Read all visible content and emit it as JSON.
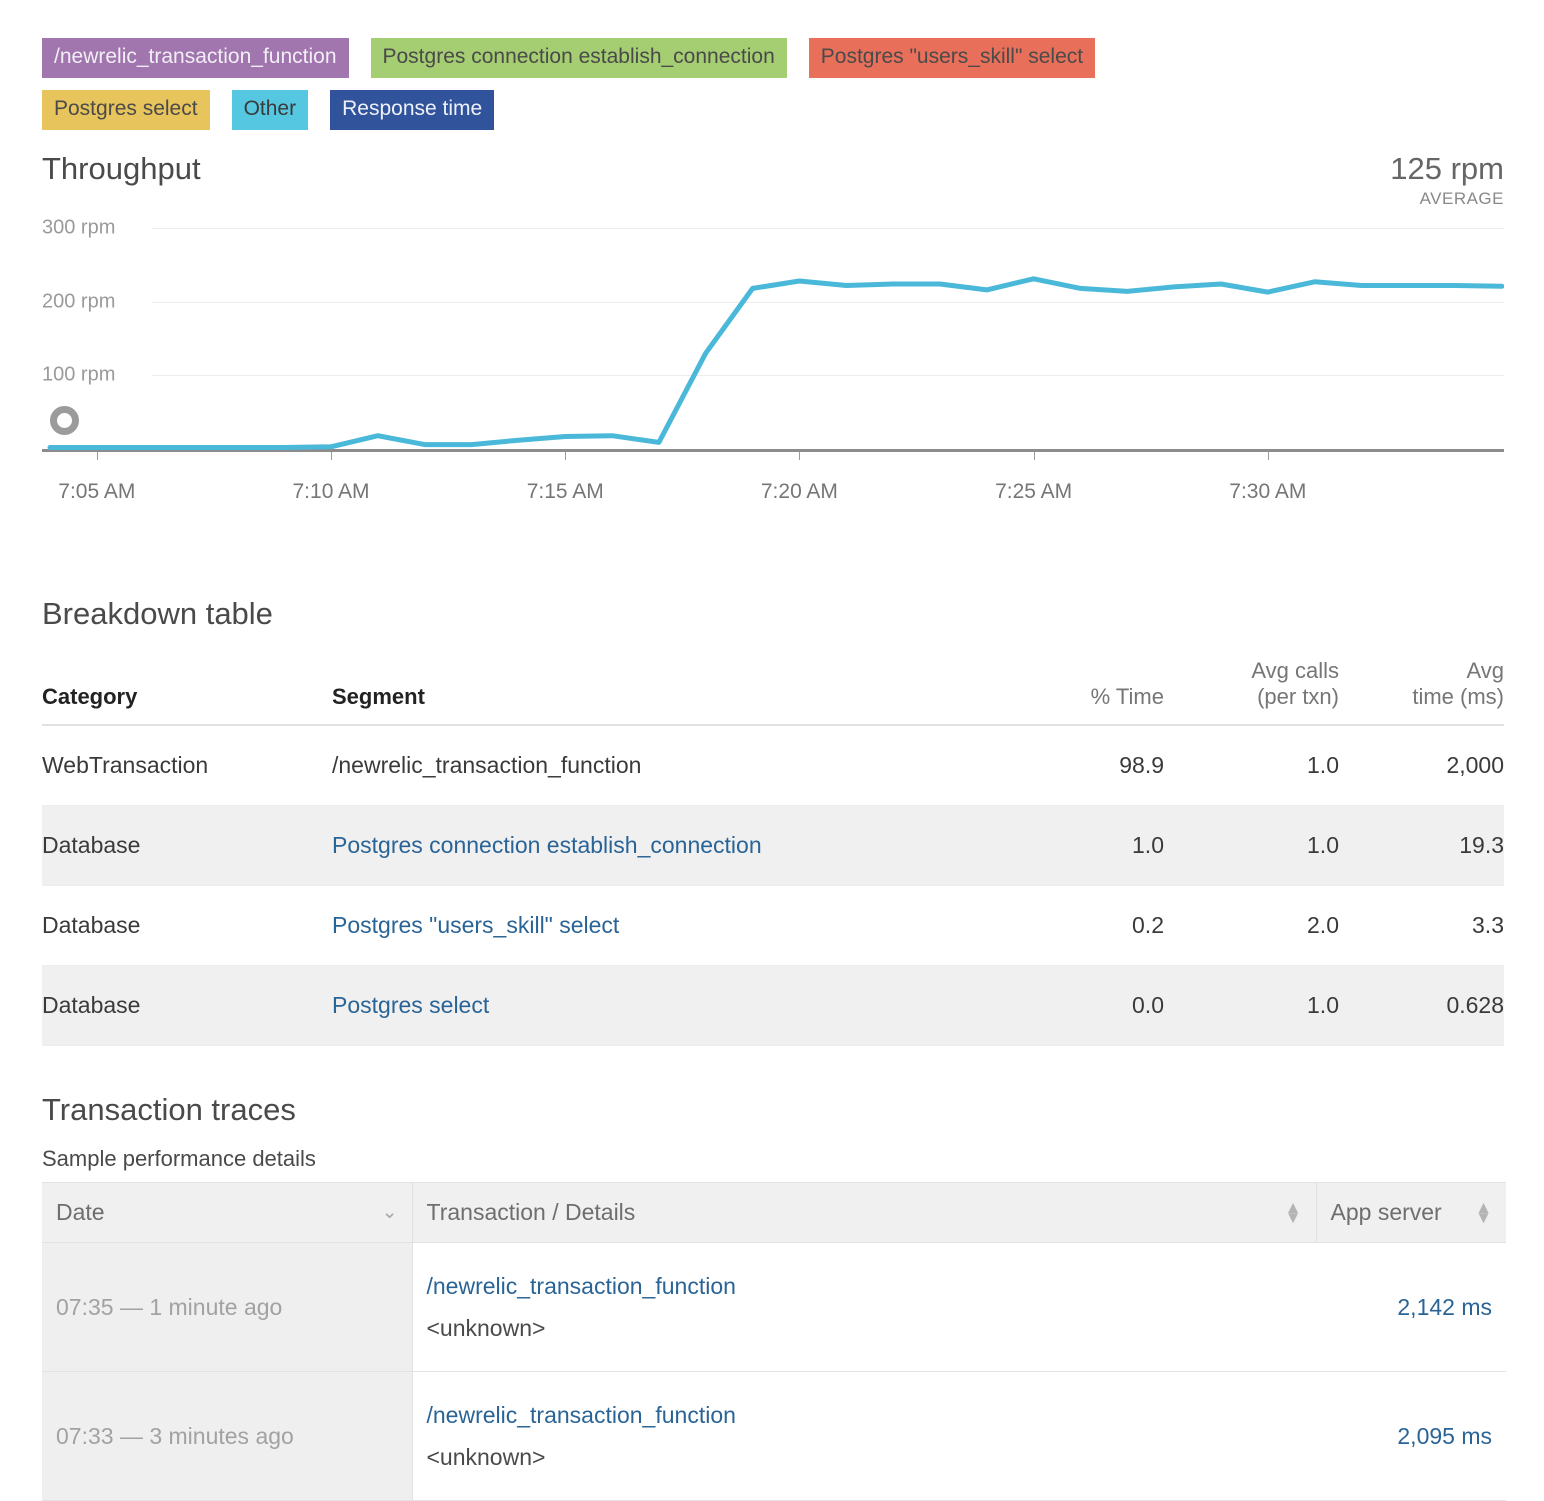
{
  "legend": {
    "rows": [
      [
        {
          "label": "/newrelic_transaction_function",
          "bg": "#a175ae",
          "fg": "#f2eef5"
        },
        {
          "label": "Postgres connection establish_connection",
          "bg": "#a5cd72",
          "fg": "#4a4a4a"
        },
        {
          "label": "Postgres \"users_skill\" select",
          "bg": "#e8705a",
          "fg": "#4a4a4a"
        }
      ],
      [
        {
          "label": "Postgres select",
          "bg": "#e8c45c",
          "fg": "#4a4a4a"
        },
        {
          "label": "Other",
          "bg": "#55c7e0",
          "fg": "#3a3a3a"
        },
        {
          "label": "Response time",
          "bg": "#31539c",
          "fg": "#eef1f8"
        }
      ]
    ]
  },
  "chart_data": {
    "type": "line",
    "title": "Throughput",
    "metric_value": "125 rpm",
    "metric_label": "AVERAGE",
    "xlabel": "",
    "ylabel": "rpm",
    "ylim": [
      0,
      300
    ],
    "yticks": [
      100,
      200,
      300
    ],
    "ytick_labels": [
      "100 rpm",
      "200 rpm",
      "300 rpm"
    ],
    "xticks": [
      "7:05 AM",
      "7:10 AM",
      "7:15 AM",
      "7:20 AM",
      "7:25 AM",
      "7:30 AM"
    ],
    "grid": true,
    "legend_position": "none",
    "line_color": "#4ab8d8",
    "handle_marker": {
      "value": 0,
      "x_label": "7:04 AM"
    },
    "series": [
      {
        "name": "Throughput",
        "x": [
          "7:04",
          "7:05",
          "7:06",
          "7:07",
          "7:08",
          "7:09",
          "7:10",
          "7:11",
          "7:12",
          "7:13",
          "7:14",
          "7:15",
          "7:16",
          "7:17",
          "7:18",
          "7:19",
          "7:20",
          "7:21",
          "7:22",
          "7:23",
          "7:24",
          "7:25",
          "7:26",
          "7:27",
          "7:28",
          "7:29",
          "7:30",
          "7:31",
          "7:32",
          "7:33",
          "7:34",
          "7:35"
        ],
        "values": [
          2,
          2,
          2,
          2,
          2,
          2,
          3,
          18,
          6,
          6,
          12,
          17,
          18,
          9,
          130,
          218,
          228,
          222,
          224,
          224,
          216,
          231,
          218,
          214,
          220,
          224,
          213,
          227,
          222,
          222,
          222,
          221
        ]
      }
    ]
  },
  "breakdown": {
    "title": "Breakdown table",
    "columns": [
      {
        "label": "Category",
        "sublabel": "",
        "strong": true
      },
      {
        "label": "Segment",
        "sublabel": "",
        "strong": true
      },
      {
        "label": "",
        "sublabel": "% Time",
        "strong": false
      },
      {
        "label": "Avg calls",
        "sublabel": "(per txn)",
        "strong": false
      },
      {
        "label": "Avg",
        "sublabel": "time (ms)",
        "strong": false
      }
    ],
    "rows": [
      {
        "category": "WebTransaction",
        "segment": "/newrelic_transaction_function",
        "is_link": false,
        "pct_time": "98.9",
        "avg_calls": "1.0",
        "avg_time": "2,000"
      },
      {
        "category": "Database",
        "segment": "Postgres connection establish_connection",
        "is_link": true,
        "pct_time": "1.0",
        "avg_calls": "1.0",
        "avg_time": "19.3"
      },
      {
        "category": "Database",
        "segment": "Postgres \"users_skill\" select",
        "is_link": true,
        "pct_time": "0.2",
        "avg_calls": "2.0",
        "avg_time": "3.3"
      },
      {
        "category": "Database",
        "segment": "Postgres select",
        "is_link": true,
        "pct_time": "0.0",
        "avg_calls": "1.0",
        "avg_time": "0.628"
      }
    ]
  },
  "traces": {
    "title": "Transaction traces",
    "subtitle": "Sample performance details",
    "columns": [
      {
        "label": "Date",
        "sort_icon": "chevron-down-icon"
      },
      {
        "label": "Transaction / Details",
        "sort_icon": "sort-updown-icon"
      },
      {
        "label": "App server",
        "sort_icon": "sort-updown-icon"
      }
    ],
    "rows": [
      {
        "date": "07:35 — 1 minute ago",
        "transaction": "/newrelic_transaction_function",
        "details": "<unknown>",
        "app_server": "2,142 ms"
      },
      {
        "date": "07:33 — 3 minutes ago",
        "transaction": "/newrelic_transaction_function",
        "details": "<unknown>",
        "app_server": "2,095 ms"
      }
    ]
  }
}
